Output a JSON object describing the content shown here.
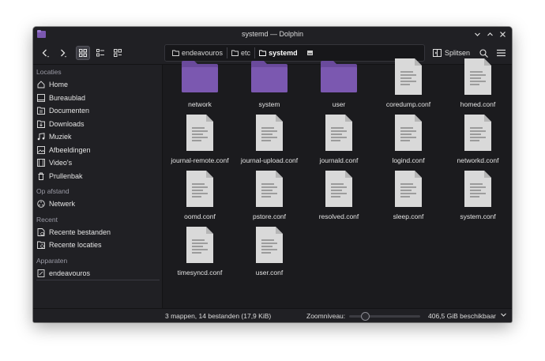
{
  "window": {
    "title": "systemd — Dolphin"
  },
  "toolbar": {
    "breadcrumb": [
      {
        "label": "endeavouros"
      },
      {
        "label": "etc"
      },
      {
        "label": "systemd"
      }
    ],
    "split_label": "Splitsen"
  },
  "sidebar": {
    "sections": {
      "places": "Locaties",
      "remote": "Op afstand",
      "recent": "Recent",
      "devices": "Apparaten"
    },
    "places": [
      {
        "label": "Home",
        "icon": "home-icon"
      },
      {
        "label": "Bureaublad",
        "icon": "desktop-icon"
      },
      {
        "label": "Documenten",
        "icon": "documents-icon"
      },
      {
        "label": "Downloads",
        "icon": "downloads-icon"
      },
      {
        "label": "Muziek",
        "icon": "music-icon"
      },
      {
        "label": "Afbeeldingen",
        "icon": "pictures-icon"
      },
      {
        "label": "Video's",
        "icon": "videos-icon"
      },
      {
        "label": "Prullenbak",
        "icon": "trash-icon"
      }
    ],
    "remote": [
      {
        "label": "Netwerk",
        "icon": "network-icon"
      }
    ],
    "recent": [
      {
        "label": "Recente bestanden",
        "icon": "recent-files-icon"
      },
      {
        "label": "Recente locaties",
        "icon": "recent-locations-icon"
      }
    ],
    "devices": [
      {
        "label": "endeavouros",
        "icon": "drive-icon"
      }
    ]
  },
  "files": [
    {
      "name": "network",
      "type": "folder"
    },
    {
      "name": "system",
      "type": "folder"
    },
    {
      "name": "user",
      "type": "folder"
    },
    {
      "name": "coredump.conf",
      "type": "file"
    },
    {
      "name": "homed.conf",
      "type": "file"
    },
    {
      "name": "journal-remote.conf",
      "type": "file"
    },
    {
      "name": "journal-upload.conf",
      "type": "file"
    },
    {
      "name": "journald.conf",
      "type": "file"
    },
    {
      "name": "logind.conf",
      "type": "file"
    },
    {
      "name": "networkd.conf",
      "type": "file"
    },
    {
      "name": "oomd.conf",
      "type": "file"
    },
    {
      "name": "pstore.conf",
      "type": "file"
    },
    {
      "name": "resolved.conf",
      "type": "file"
    },
    {
      "name": "sleep.conf",
      "type": "file"
    },
    {
      "name": "system.conf",
      "type": "file"
    },
    {
      "name": "timesyncd.conf",
      "type": "file"
    },
    {
      "name": "user.conf",
      "type": "file"
    }
  ],
  "status": {
    "summary": "3 mappen, 14 bestanden (17,9 KiB)",
    "zoom_label": "Zoomniveau:",
    "zoom_level": 0.22,
    "free_space": "406,5 GiB beschikbaar"
  },
  "colors": {
    "folder": "#7b58b0",
    "folder_tab": "#6a4a9c",
    "document": "#d9d9d9",
    "accent": "#3daee9"
  }
}
